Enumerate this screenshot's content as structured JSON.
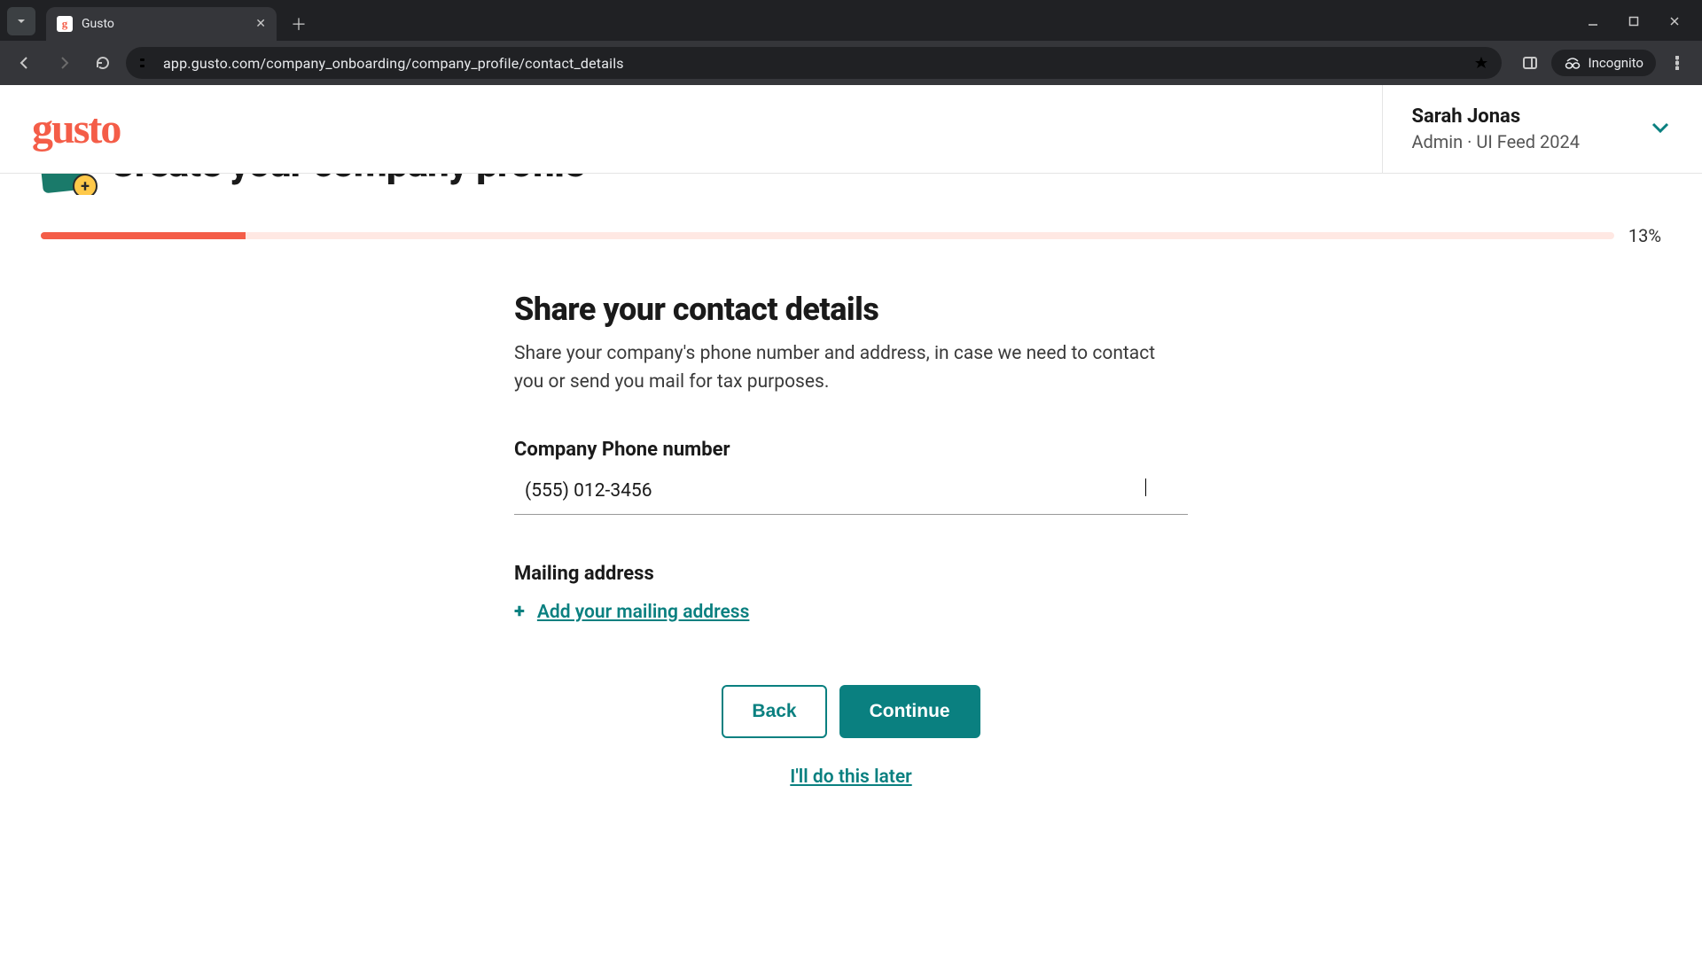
{
  "browser": {
    "tab_title": "Gusto",
    "favicon_letter": "g",
    "url": "app.gusto.com/company_onboarding/company_profile/contact_details",
    "incognito_label": "Incognito"
  },
  "header": {
    "logo_text": "gusto",
    "user_name": "Sarah Jonas",
    "user_role_line": "Admin · UI Feed 2024"
  },
  "wizard": {
    "step_title": "Create your company profile",
    "progress_percent_label": "13%",
    "progress_percent": 13
  },
  "form": {
    "heading": "Share your contact details",
    "subtext": "Share your company's phone number and address, in case we need to contact you or send you mail for tax purposes.",
    "phone_label": "Company Phone number",
    "phone_value": "(555) 012-3456",
    "mailing_label": "Mailing address",
    "add_mailing_link": "Add your mailing address"
  },
  "buttons": {
    "back": "Back",
    "continue": "Continue",
    "skip": "I'll do this later"
  }
}
